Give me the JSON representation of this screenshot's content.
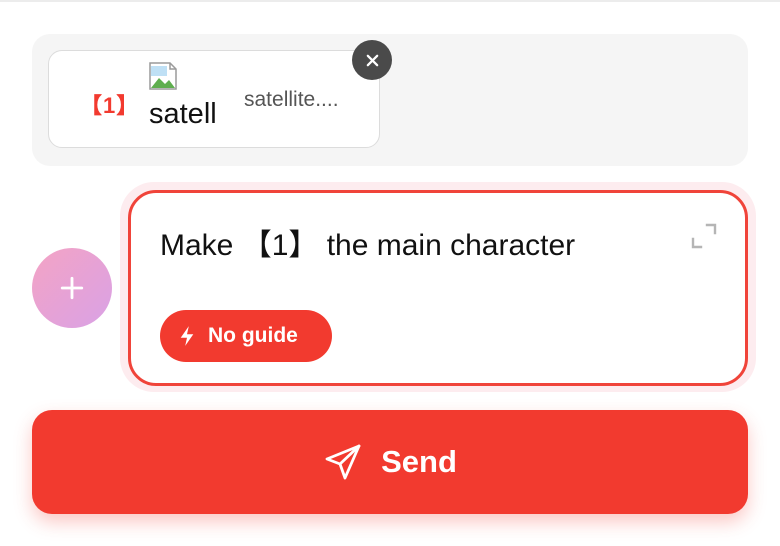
{
  "attachment": {
    "ref": "【1】",
    "thumbnail_alt": "satell",
    "file_name": "satellite...."
  },
  "prompt": {
    "text": "Make 【1】 the main character",
    "guide_chip_label": "No guide"
  },
  "send": {
    "label": "Send"
  },
  "icons": {
    "remove": "close-icon",
    "add": "plus-icon",
    "expand": "expand-icon",
    "guide": "lightning-icon",
    "send": "paper-plane-icon",
    "thumbnail": "broken-image-icon"
  },
  "colors": {
    "accent": "#f23a2f",
    "prompt_border": "#f0443a",
    "plus_gradient_start": "#f4a3c4",
    "plus_gradient_end": "#d9a2e6",
    "remove_button": "#4a4a4a",
    "tray_background": "#f5f5f5"
  }
}
